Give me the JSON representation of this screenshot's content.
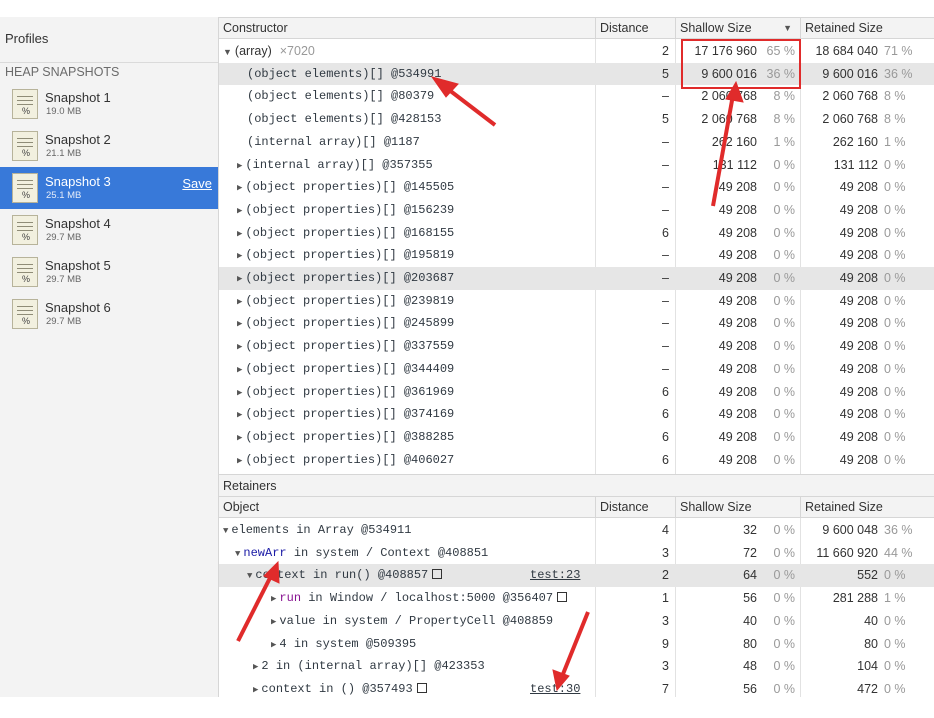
{
  "sidebar": {
    "title": "Profiles",
    "section": "HEAP SNAPSHOTS",
    "snapshots": [
      {
        "name": "Snapshot 1",
        "size": "19.0 MB"
      },
      {
        "name": "Snapshot 2",
        "size": "21.1 MB"
      },
      {
        "name": "Snapshot 3",
        "size": "25.1 MB",
        "action": "Save"
      },
      {
        "name": "Snapshot 4",
        "size": "29.7 MB"
      },
      {
        "name": "Snapshot 5",
        "size": "29.7 MB"
      },
      {
        "name": "Snapshot 6",
        "size": "29.7 MB"
      }
    ],
    "thumb_label": "%"
  },
  "constructor_table": {
    "headers": [
      "Constructor",
      "Distance",
      "Shallow Size",
      "Retained Size"
    ],
    "rows": [
      {
        "name": "(array)",
        "count": "×7020",
        "distance": "2",
        "shallow": "17 176 960",
        "shallow_pct": "65 %",
        "retained": "18 684 040",
        "retained_pct": "71 %"
      },
      {
        "name": "(object elements)[] @534991",
        "distance": "5",
        "shallow": "9 600 016",
        "shallow_pct": "36 %",
        "retained": "9 600 016",
        "retained_pct": "36 %"
      },
      {
        "name": "(object elements)[] @80379",
        "distance": "–",
        "shallow": "2 060 768",
        "shallow_pct": "8 %",
        "retained": "2 060 768",
        "retained_pct": "8 %"
      },
      {
        "name": "(object elements)[] @428153",
        "distance": "5",
        "shallow": "2 060 768",
        "shallow_pct": "8 %",
        "retained": "2 060 768",
        "retained_pct": "8 %"
      },
      {
        "name": "(internal array)[] @1187",
        "distance": "–",
        "shallow": "262 160",
        "shallow_pct": "1 %",
        "retained": "262 160",
        "retained_pct": "1 %"
      },
      {
        "name": "(internal array)[] @357355",
        "distance": "–",
        "shallow": "131 112",
        "shallow_pct": "0 %",
        "retained": "131 112",
        "retained_pct": "0 %"
      },
      {
        "name": "(object properties)[] @145505",
        "distance": "–",
        "shallow": "49 208",
        "shallow_pct": "0 %",
        "retained": "49 208",
        "retained_pct": "0 %"
      },
      {
        "name": "(object properties)[] @156239",
        "distance": "–",
        "shallow": "49 208",
        "shallow_pct": "0 %",
        "retained": "49 208",
        "retained_pct": "0 %"
      },
      {
        "name": "(object properties)[] @168155",
        "distance": "6",
        "shallow": "49 208",
        "shallow_pct": "0 %",
        "retained": "49 208",
        "retained_pct": "0 %"
      },
      {
        "name": "(object properties)[] @195819",
        "distance": "–",
        "shallow": "49 208",
        "shallow_pct": "0 %",
        "retained": "49 208",
        "retained_pct": "0 %"
      },
      {
        "name": "(object properties)[] @203687",
        "distance": "–",
        "shallow": "49 208",
        "shallow_pct": "0 %",
        "retained": "49 208",
        "retained_pct": "0 %"
      },
      {
        "name": "(object properties)[] @239819",
        "distance": "–",
        "shallow": "49 208",
        "shallow_pct": "0 %",
        "retained": "49 208",
        "retained_pct": "0 %"
      },
      {
        "name": "(object properties)[] @245899",
        "distance": "–",
        "shallow": "49 208",
        "shallow_pct": "0 %",
        "retained": "49 208",
        "retained_pct": "0 %"
      },
      {
        "name": "(object properties)[] @337559",
        "distance": "–",
        "shallow": "49 208",
        "shallow_pct": "0 %",
        "retained": "49 208",
        "retained_pct": "0 %"
      },
      {
        "name": "(object properties)[] @344409",
        "distance": "–",
        "shallow": "49 208",
        "shallow_pct": "0 %",
        "retained": "49 208",
        "retained_pct": "0 %"
      },
      {
        "name": "(object properties)[] @361969",
        "distance": "6",
        "shallow": "49 208",
        "shallow_pct": "0 %",
        "retained": "49 208",
        "retained_pct": "0 %"
      },
      {
        "name": "(object properties)[] @374169",
        "distance": "6",
        "shallow": "49 208",
        "shallow_pct": "0 %",
        "retained": "49 208",
        "retained_pct": "0 %"
      },
      {
        "name": "(object properties)[] @388285",
        "distance": "6",
        "shallow": "49 208",
        "shallow_pct": "0 %",
        "retained": "49 208",
        "retained_pct": "0 %"
      },
      {
        "name": "(object properties)[] @406027",
        "distance": "6",
        "shallow": "49 208",
        "shallow_pct": "0 %",
        "retained": "49 208",
        "retained_pct": "0 %"
      }
    ]
  },
  "retainers": {
    "label": "Retainers",
    "headers": [
      "Object",
      "Distance",
      "Shallow Size",
      "Retained Size"
    ],
    "rows": [
      {
        "prefix": "elements",
        "middle": " in Array @534911",
        "link": "",
        "distance": "4",
        "shallow": "32",
        "shallow_pct": "0 %",
        "retained": "9 600 048",
        "retained_pct": "36 %"
      },
      {
        "prefix": "newArr",
        "middle": " in system / Context @408851",
        "link": "",
        "distance": "3",
        "shallow": "72",
        "shallow_pct": "0 %",
        "retained": "11 660 920",
        "retained_pct": "44 %"
      },
      {
        "prefix": "context",
        "middle": " in run() @408857",
        "link": "test:23",
        "distance": "2",
        "shallow": "64",
        "shallow_pct": "0 %",
        "retained": "552",
        "retained_pct": "0 %"
      },
      {
        "prefix": "run",
        "middle": " in Window / localhost:5000 @356407",
        "link": "",
        "distance": "1",
        "shallow": "56",
        "shallow_pct": "0 %",
        "retained": "281 288",
        "retained_pct": "1 %"
      },
      {
        "prefix": "value",
        "middle": " in system / PropertyCell @408859",
        "link": "",
        "distance": "3",
        "shallow": "40",
        "shallow_pct": "0 %",
        "retained": "40",
        "retained_pct": "0 %"
      },
      {
        "prefix": "4",
        "middle": " in system @509395",
        "link": "",
        "distance": "9",
        "shallow": "80",
        "shallow_pct": "0 %",
        "retained": "80",
        "retained_pct": "0 %"
      },
      {
        "prefix": "2",
        "middle": " in (internal array)[] @423353",
        "link": "",
        "distance": "3",
        "shallow": "48",
        "shallow_pct": "0 %",
        "retained": "104",
        "retained_pct": "0 %"
      },
      {
        "prefix": "context",
        "middle": " in () @357493",
        "link": "test:30",
        "distance": "7",
        "shallow": "56",
        "shallow_pct": "0 %",
        "retained": "472",
        "retained_pct": "0 %"
      }
    ]
  },
  "colors": {
    "selection": "#3879d9",
    "annotation": "#e02b2b"
  }
}
